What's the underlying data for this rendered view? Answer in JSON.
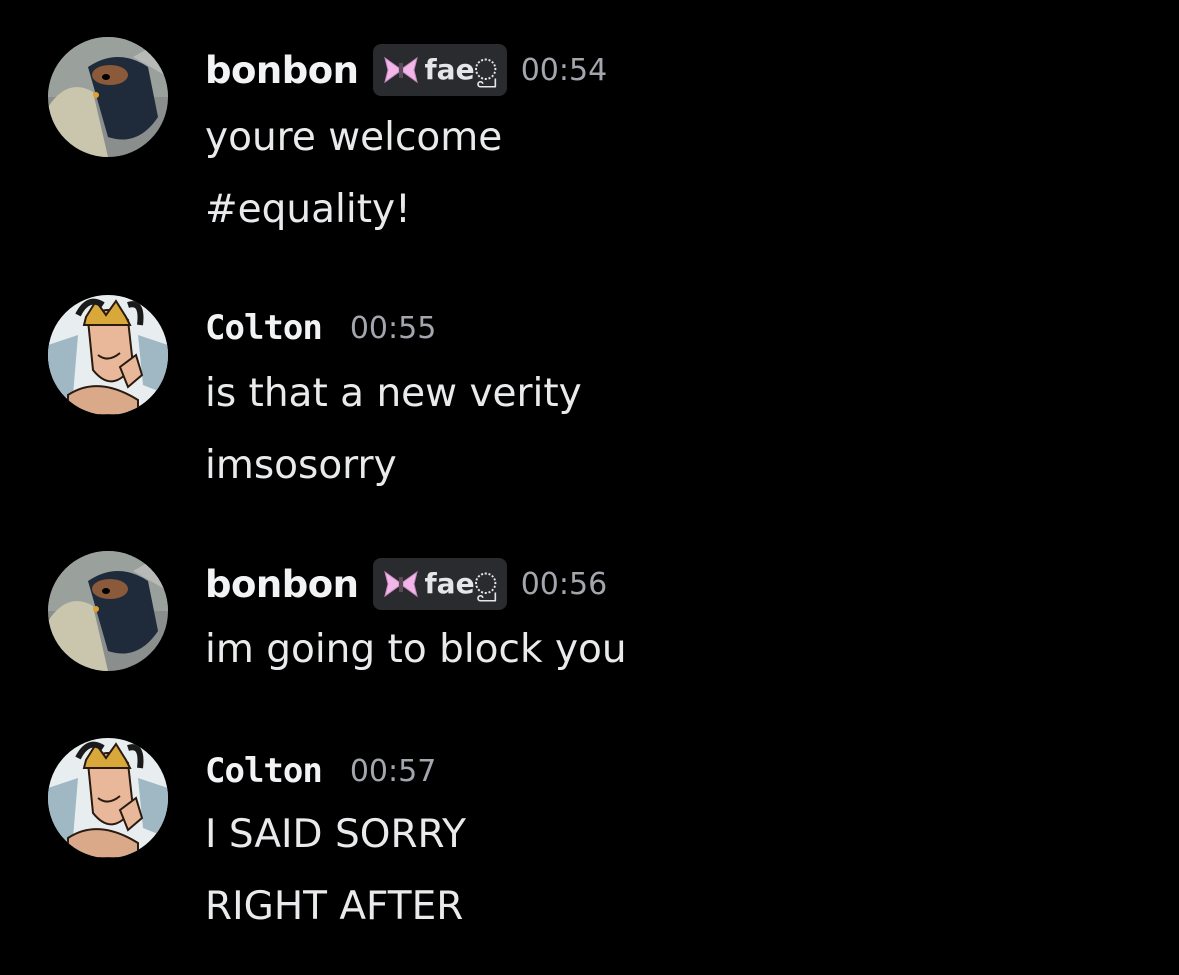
{
  "messages": [
    {
      "author": "bonbon",
      "tag": "faeු",
      "tag_icon": "butterfly-icon",
      "time": "00:54",
      "lines": [
        "youre welcome",
        "#equality!"
      ]
    },
    {
      "author": "Colton",
      "time": "00:55",
      "lines": [
        "is that a new verity",
        "imsosorry"
      ]
    },
    {
      "author": "bonbon",
      "tag": "faeු",
      "tag_icon": "butterfly-icon",
      "time": "00:56",
      "lines": [
        "im going to block you"
      ]
    },
    {
      "author": "Colton",
      "time": "00:57",
      "lines": [
        "I SAID SORRY",
        "RIGHT AFTER"
      ]
    }
  ],
  "colors": {
    "background": "#000000",
    "username": "#f2f3f5",
    "timestamp": "#a3a6ad",
    "tag_bg": "#2a2b2f",
    "butterfly": "#f3b6e8"
  }
}
